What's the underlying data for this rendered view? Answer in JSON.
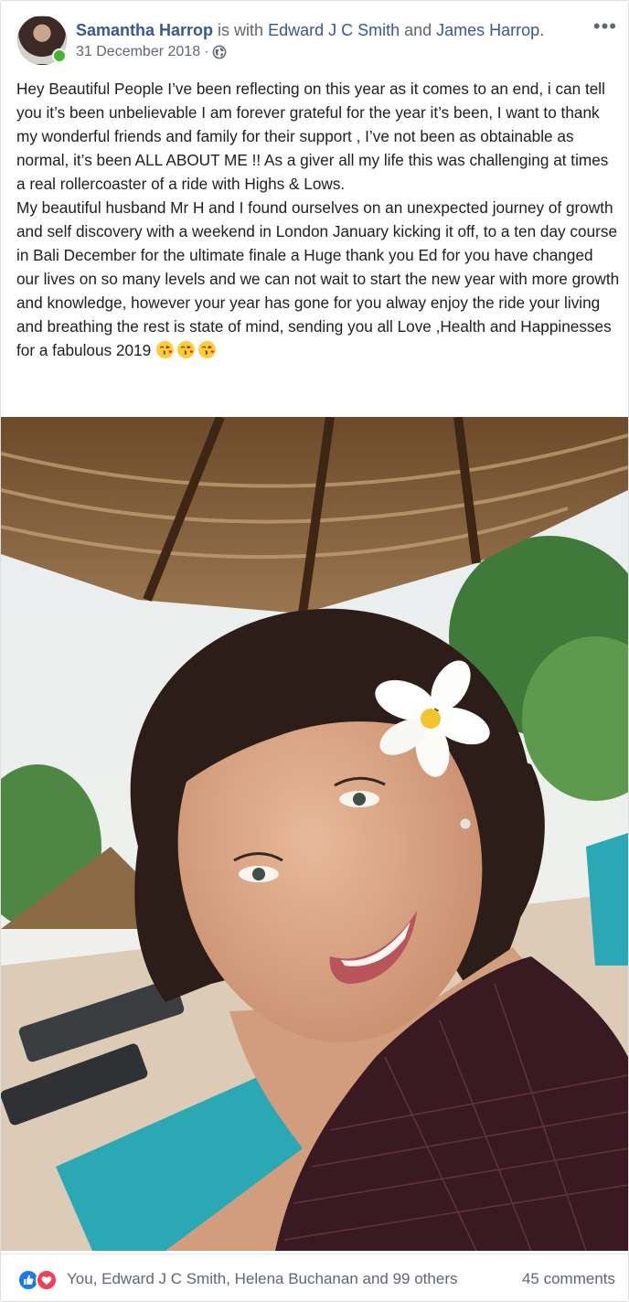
{
  "post": {
    "author": "Samantha Harrop",
    "with_text": " is with ",
    "tagged_1": "Edward J C Smith",
    "and_text": " and ",
    "tagged_2": "James Harrop",
    "period": ".",
    "date": "31 December 2018",
    "separator": "·",
    "privacy_icon": "globe-icon",
    "more_label": "•••",
    "paragraph_1": "Hey Beautiful People I’ve been reflecting on this year as it comes to an end, i can tell you it’s been unbelievable I am forever grateful for the year it’s been, I want to thank my wonderful friends and family for their support , I’ve not been as obtainable as normal, it’s been ALL ABOUT ME !! As a giver all my life this was challenging at times a real rollercoaster of a ride with Highs & Lows.",
    "paragraph_2": "My beautiful husband Mr H and I found ourselves on an unexpected journey of growth and self discovery with a weekend in London January kicking it off, to a ten day course in Bali December for the ultimate finale a Huge thank you Ed for you have changed our lives on so many levels and we can not wait to start the new year with more growth and knowledge, however your year has gone for you alway enjoy the ride your living and breathing the rest is state of mind, sending you all Love ,Health and Happinesses for a fabulous 2019 ",
    "emoji": [
      "kissing-heart-emoji",
      "kissing-heart-emoji",
      "kissing-heart-emoji"
    ]
  },
  "footer": {
    "reaction_icons": [
      "like-icon",
      "love-icon"
    ],
    "likers": "You, Edward J C Smith, Helena Buchanan and 99 others",
    "comments": "45 comments"
  },
  "colors": {
    "link": "#365899",
    "meta": "#616770",
    "online": "#42b72a",
    "like": "#1877f2",
    "love": "#f33e58"
  }
}
